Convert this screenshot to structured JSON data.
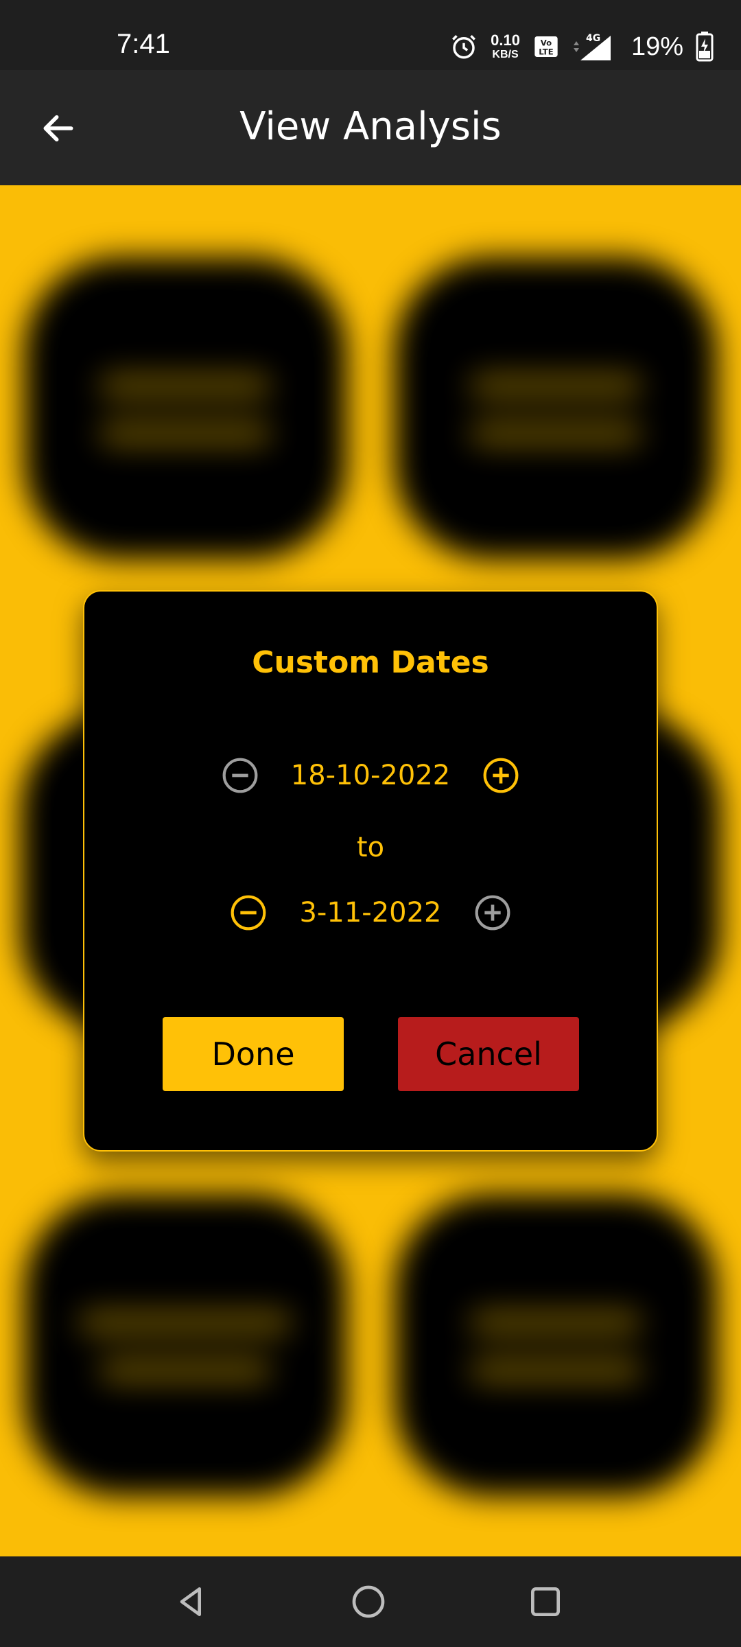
{
  "status_bar": {
    "time": "7:41",
    "net_speed_value": "0.10",
    "net_speed_unit": "KB/S",
    "network_type": "4G",
    "volte_label": "Vo LTE",
    "battery_percent": "19%"
  },
  "app_bar": {
    "title": "View Analysis"
  },
  "dialog": {
    "title": "Custom Dates",
    "start_date": "18-10-2022",
    "separator": "to",
    "end_date": "3-11-2022",
    "done_label": "Done",
    "cancel_label": "Cancel"
  },
  "colors": {
    "accent": "#ffc107",
    "cancel": "#b71c1c",
    "dialog_bg": "#000000",
    "app_bar": "#262626",
    "disabled_icon": "#9e9e9e"
  },
  "icons": {
    "start_decrement": "minus-circle-icon (disabled, grey)",
    "start_increment": "plus-circle-icon (active, yellow)",
    "end_decrement": "minus-circle-icon (active, yellow)",
    "end_increment": "plus-circle-icon (disabled, grey)"
  }
}
